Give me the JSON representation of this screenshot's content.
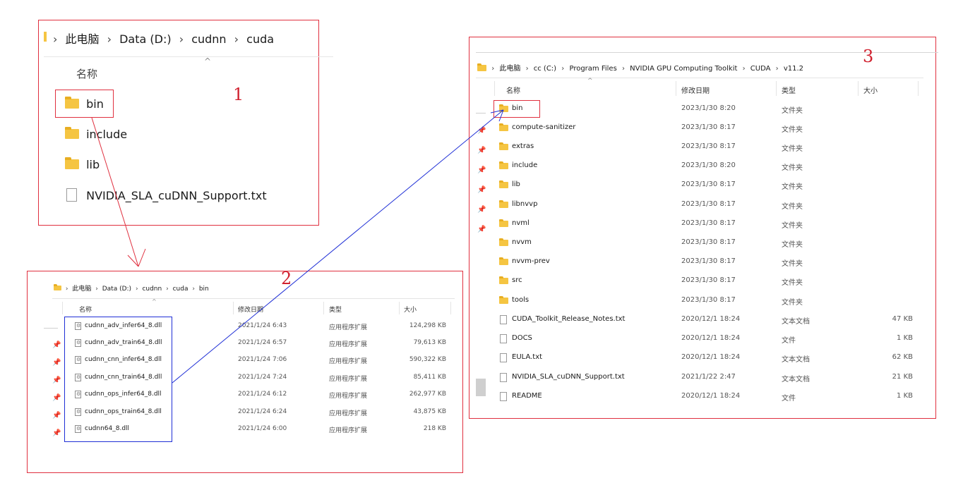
{
  "panel1": {
    "breadcrumb": [
      "此电脑",
      "Data (D:)",
      "cudnn",
      "cuda"
    ],
    "column_name": "名称",
    "items": [
      {
        "name": "bin",
        "type": "folder"
      },
      {
        "name": "include",
        "type": "folder"
      },
      {
        "name": "lib",
        "type": "folder"
      },
      {
        "name": "NVIDIA_SLA_cuDNN_Support.txt",
        "type": "file"
      }
    ],
    "annotation": "1"
  },
  "panel2": {
    "breadcrumb": [
      "此电脑",
      "Data (D:)",
      "cudnn",
      "cuda",
      "bin"
    ],
    "columns": [
      "名称",
      "修改日期",
      "类型",
      "大小"
    ],
    "items": [
      {
        "name": "cudnn_adv_infer64_8.dll",
        "date": "2021/1/24 6:43",
        "type": "应用程序扩展",
        "size": "124,298 KB"
      },
      {
        "name": "cudnn_adv_train64_8.dll",
        "date": "2021/1/24 6:57",
        "type": "应用程序扩展",
        "size": "79,613 KB"
      },
      {
        "name": "cudnn_cnn_infer64_8.dll",
        "date": "2021/1/24 7:06",
        "type": "应用程序扩展",
        "size": "590,322 KB"
      },
      {
        "name": "cudnn_cnn_train64_8.dll",
        "date": "2021/1/24 7:24",
        "type": "应用程序扩展",
        "size": "85,411 KB"
      },
      {
        "name": "cudnn_ops_infer64_8.dll",
        "date": "2021/1/24 6:12",
        "type": "应用程序扩展",
        "size": "262,977 KB"
      },
      {
        "name": "cudnn_ops_train64_8.dll",
        "date": "2021/1/24 6:24",
        "type": "应用程序扩展",
        "size": "43,875 KB"
      },
      {
        "name": "cudnn64_8.dll",
        "date": "2021/1/24 6:00",
        "type": "应用程序扩展",
        "size": "218 KB"
      }
    ],
    "annotation": "2"
  },
  "panel3": {
    "breadcrumb": [
      "此电脑",
      "cc (C:)",
      "Program Files",
      "NVIDIA GPU Computing Toolkit",
      "CUDA",
      "v11.2"
    ],
    "columns": [
      "名称",
      "修改日期",
      "类型",
      "大小"
    ],
    "items": [
      {
        "name": "bin",
        "date": "2023/1/30 8:20",
        "type": "文件夹",
        "size": "",
        "kind": "folder"
      },
      {
        "name": "compute-sanitizer",
        "date": "2023/1/30 8:17",
        "type": "文件夹",
        "size": "",
        "kind": "folder"
      },
      {
        "name": "extras",
        "date": "2023/1/30 8:17",
        "type": "文件夹",
        "size": "",
        "kind": "folder"
      },
      {
        "name": "include",
        "date": "2023/1/30 8:20",
        "type": "文件夹",
        "size": "",
        "kind": "folder"
      },
      {
        "name": "lib",
        "date": "2023/1/30 8:17",
        "type": "文件夹",
        "size": "",
        "kind": "folder"
      },
      {
        "name": "libnvvp",
        "date": "2023/1/30 8:17",
        "type": "文件夹",
        "size": "",
        "kind": "folder"
      },
      {
        "name": "nvml",
        "date": "2023/1/30 8:17",
        "type": "文件夹",
        "size": "",
        "kind": "folder"
      },
      {
        "name": "nvvm",
        "date": "2023/1/30 8:17",
        "type": "文件夹",
        "size": "",
        "kind": "folder"
      },
      {
        "name": "nvvm-prev",
        "date": "2023/1/30 8:17",
        "type": "文件夹",
        "size": "",
        "kind": "folder"
      },
      {
        "name": "src",
        "date": "2023/1/30 8:17",
        "type": "文件夹",
        "size": "",
        "kind": "folder"
      },
      {
        "name": "tools",
        "date": "2023/1/30 8:17",
        "type": "文件夹",
        "size": "",
        "kind": "folder"
      },
      {
        "name": "CUDA_Toolkit_Release_Notes.txt",
        "date": "2020/12/1 18:24",
        "type": "文本文档",
        "size": "47 KB",
        "kind": "file"
      },
      {
        "name": "DOCS",
        "date": "2020/12/1 18:24",
        "type": "文件",
        "size": "1 KB",
        "kind": "file"
      },
      {
        "name": "EULA.txt",
        "date": "2020/12/1 18:24",
        "type": "文本文档",
        "size": "62 KB",
        "kind": "file"
      },
      {
        "name": "NVIDIA_SLA_cuDNN_Support.txt",
        "date": "2021/1/22 2:47",
        "type": "文本文档",
        "size": "21 KB",
        "kind": "file"
      },
      {
        "name": "README",
        "date": "2020/12/1 18:24",
        "type": "文件",
        "size": "1 KB",
        "kind": "file"
      }
    ],
    "annotation": "3"
  },
  "colors": {
    "annotation_red": "#e0303f",
    "annotation_blue": "#1f2fd6",
    "folder_yellow": "#f5c542"
  }
}
